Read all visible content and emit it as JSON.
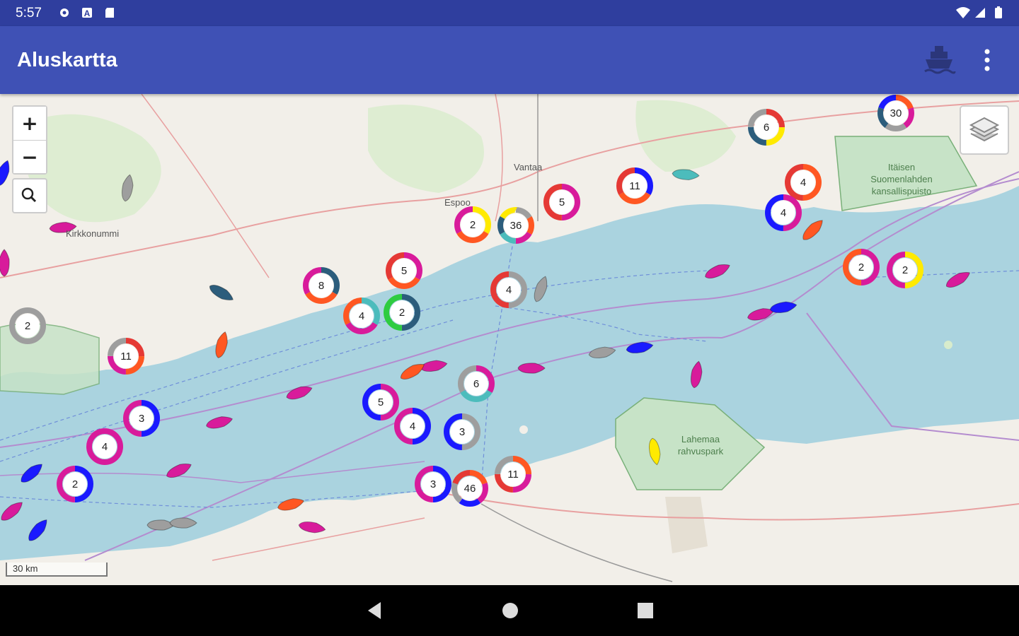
{
  "status_bar": {
    "time": "5:57"
  },
  "app_bar": {
    "title": "Aluskartta"
  },
  "map": {
    "zoom_in_label": "+",
    "zoom_out_label": "−",
    "scale_label": "30 km",
    "place_labels": [
      {
        "text": "Vantaa",
        "id": "vantaa"
      },
      {
        "text": "Espoo",
        "id": "espoo"
      },
      {
        "text": "Kirkkonummi",
        "id": "kirkkonummi"
      },
      {
        "text": "Itäisen Suomenlahden kansallispuisto",
        "id": "itainen"
      },
      {
        "text": "Lahemaa rahvuspark",
        "id": "lahemaa"
      }
    ],
    "clusters": [
      {
        "count": "2",
        "colors": [
          "#9e9e9e"
        ]
      },
      {
        "count": "11",
        "colors": [
          "#e53935",
          "#ff5722",
          "#d81b9b",
          "#9e9e9e"
        ]
      },
      {
        "count": "3",
        "colors": [
          "#1a1aff",
          "#d81b9b"
        ]
      },
      {
        "count": "4",
        "colors": [
          "#d81b9b"
        ]
      },
      {
        "count": "2",
        "colors": [
          "#1a1aff",
          "#d81b9b"
        ]
      },
      {
        "count": "8",
        "colors": [
          "#2c5d7c",
          "#ff5722",
          "#d81b9b"
        ]
      },
      {
        "count": "4",
        "colors": [
          "#4cbcbc",
          "#d81b9b",
          "#ff5722"
        ]
      },
      {
        "count": "2",
        "colors": [
          "#2c5d7c",
          "#2ecc40"
        ]
      },
      {
        "count": "5",
        "colors": [
          "#d81b9b",
          "#ff5722",
          "#e53935"
        ]
      },
      {
        "count": "2",
        "colors": [
          "#ffea00",
          "#ff5722",
          "#d81b9b"
        ]
      },
      {
        "count": "36",
        "colors": [
          "#9e9e9e",
          "#ff5722",
          "#d81b9b",
          "#4cbcbc",
          "#2c5d7c",
          "#ffea00"
        ]
      },
      {
        "count": "5",
        "colors": [
          "#d81b9b",
          "#e53935"
        ]
      },
      {
        "count": "4",
        "colors": [
          "#9e9e9e",
          "#e53935"
        ]
      },
      {
        "count": "11",
        "colors": [
          "#1a1aff",
          "#ff5722",
          "#e53935"
        ]
      },
      {
        "count": "6",
        "colors": [
          "#d81b9b",
          "#4cbcbc",
          "#9e9e9e"
        ]
      },
      {
        "count": "5",
        "colors": [
          "#d81b9b",
          "#1a1aff"
        ]
      },
      {
        "count": "4",
        "colors": [
          "#1a1aff",
          "#d81b9b"
        ]
      },
      {
        "count": "3",
        "colors": [
          "#9e9e9e",
          "#1a1aff"
        ]
      },
      {
        "count": "3",
        "colors": [
          "#1a1aff",
          "#d81b9b"
        ]
      },
      {
        "count": "46",
        "colors": [
          "#ff5722",
          "#d81b9b",
          "#1a1aff",
          "#9e9e9e",
          "#e53935"
        ]
      },
      {
        "count": "11",
        "colors": [
          "#ff5722",
          "#d81b9b",
          "#e53935",
          "#9e9e9e"
        ]
      },
      {
        "count": "6",
        "colors": [
          "#e53935",
          "#ffea00",
          "#2c5d7c",
          "#9e9e9e"
        ]
      },
      {
        "count": "30",
        "colors": [
          "#ff5722",
          "#d81b9b",
          "#9e9e9e",
          "#2c5d7c",
          "#1a1aff"
        ]
      },
      {
        "count": "4",
        "colors": [
          "#ff5722",
          "#e53935"
        ]
      },
      {
        "count": "4",
        "colors": [
          "#d81b9b",
          "#1a1aff"
        ]
      },
      {
        "count": "2",
        "colors": [
          "#d81b9b",
          "#ff5722"
        ]
      },
      {
        "count": "2",
        "colors": [
          "#ffea00",
          "#d81b9b"
        ]
      }
    ],
    "vessels": [
      {
        "type": "passenger",
        "color": "#d81b9b"
      },
      {
        "type": "unknown",
        "color": "#9e9e9e"
      },
      {
        "type": "tug",
        "color": "#2c5d7c"
      },
      {
        "type": "tanker",
        "color": "#ff5722"
      },
      {
        "type": "passenger",
        "color": "#d81b9b"
      },
      {
        "type": "passenger",
        "color": "#d81b9b"
      },
      {
        "type": "passenger",
        "color": "#d81b9b"
      },
      {
        "type": "cargo",
        "color": "#1a1aff"
      },
      {
        "type": "cargo",
        "color": "#1a1aff"
      },
      {
        "type": "tanker",
        "color": "#ff5722"
      },
      {
        "type": "tanker",
        "color": "#ff5722"
      },
      {
        "type": "passenger",
        "color": "#d81b9b"
      },
      {
        "type": "passenger",
        "color": "#d81b9b"
      },
      {
        "type": "unknown",
        "color": "#9e9e9e"
      },
      {
        "type": "unknown",
        "color": "#9e9e9e"
      },
      {
        "type": "passenger",
        "color": "#d81b9b"
      },
      {
        "type": "unknown",
        "color": "#9e9e9e"
      },
      {
        "type": "fishing",
        "color": "#4cbcbc"
      },
      {
        "type": "tanker",
        "color": "#ff5722"
      },
      {
        "type": "passenger",
        "color": "#d81b9b"
      },
      {
        "type": "passenger",
        "color": "#d81b9b"
      },
      {
        "type": "cargo",
        "color": "#1a1aff"
      },
      {
        "type": "cargo",
        "color": "#1a1aff"
      },
      {
        "type": "unknown",
        "color": "#9e9e9e"
      },
      {
        "type": "passenger",
        "color": "#d81b9b"
      },
      {
        "type": "yacht",
        "color": "#ffea00"
      },
      {
        "type": "passenger",
        "color": "#d81b9b"
      },
      {
        "type": "passenger",
        "color": "#d81b9b"
      },
      {
        "type": "passenger",
        "color": "#d81b9b"
      },
      {
        "type": "cargo",
        "color": "#1a1aff"
      }
    ]
  }
}
